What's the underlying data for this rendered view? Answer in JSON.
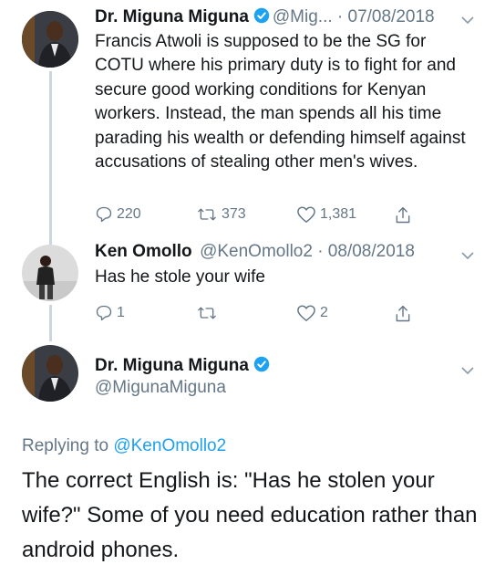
{
  "tweets": [
    {
      "author_name": "Dr. Miguna Miguna",
      "handle_date": "@Mig... · 07/08/2018",
      "text": "Francis Atwoli is supposed to be the SG for COTU where his primary duty is to fight for and secure good working conditions for Kenyan workers. Instead, the man spends all his time parading his wealth or defending himself against accusations of stealing other men's wives.",
      "reply_count": "220",
      "retweet_count": "373",
      "like_count": "1,381"
    },
    {
      "author_name": "Ken Omollo",
      "handle_date": "@KenOmollo2 · 08/08/2018",
      "text": "Has he stole your wife",
      "reply_count": "1",
      "retweet_count": "",
      "like_count": "2"
    }
  ],
  "main_tweet": {
    "author_name": "Dr. Miguna Miguna",
    "handle": "@MigunaMiguna",
    "replying_prefix": "Replying to",
    "replying_to": "@KenOmollo2",
    "text": "The correct English is: \"Has he stolen your wife?\" Some of you need education rather than android phones."
  },
  "colors": {
    "verified": "#1da1f2",
    "muted": "#657786",
    "thread_line": "#ccd6dd",
    "link": "#1da1f2"
  },
  "icons": {
    "verified": "verified-badge-icon",
    "reply": "reply-icon",
    "retweet": "retweet-icon",
    "like": "heart-icon",
    "share": "share-icon",
    "more": "chevron-down-icon"
  }
}
